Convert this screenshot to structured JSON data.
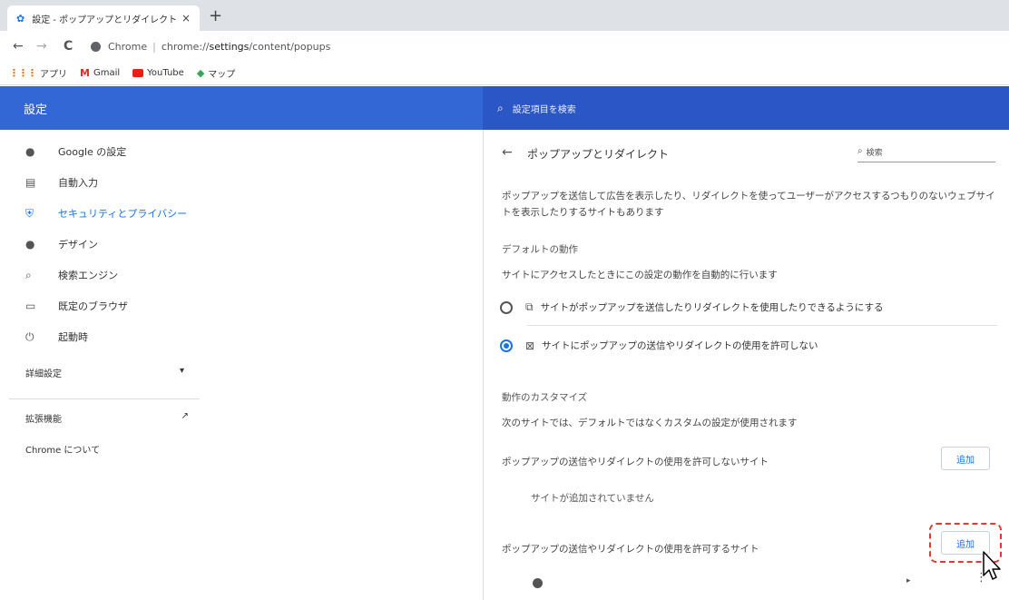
{
  "tab": {
    "title": "設定 - ポップアップとリダイレクト",
    "close": "×",
    "new_tab": "+"
  },
  "address": {
    "back": "←",
    "forward": "→",
    "reload": "C",
    "site_label": "Chrome",
    "separator": "|",
    "url_prefix": "chrome://",
    "url_host": "settings",
    "url_path": "/content/popups"
  },
  "bookmarks": [
    {
      "icon": "apps-grid-icon",
      "glyph": "⋮⋮⋮",
      "label": "アプリ"
    },
    {
      "icon": "gmail-icon",
      "glyph": "M",
      "label": "Gmail"
    },
    {
      "icon": "youtube-icon",
      "glyph": "",
      "label": "YouTube"
    },
    {
      "icon": "maps-icon",
      "glyph": "◆",
      "label": "マップ"
    }
  ],
  "header": {
    "title": "設定",
    "search_placeholder": "設定項目を検索"
  },
  "sidebar": {
    "items": [
      {
        "name": "google",
        "icon": "person-icon",
        "glyph": "👤",
        "label": "Google の設定",
        "active": false
      },
      {
        "name": "autofill",
        "icon": "clipboard-icon",
        "glyph": "▤",
        "label": "自動入力",
        "active": false
      },
      {
        "name": "privacy",
        "icon": "shield-icon",
        "glyph": "⛨",
        "label": "セキュリティとプライバシー",
        "active": true
      },
      {
        "name": "design",
        "icon": "palette-icon",
        "glyph": "●",
        "label": "デザイン",
        "active": false
      },
      {
        "name": "search",
        "icon": "search-icon",
        "glyph": "⌕",
        "label": "検索エンジン",
        "active": false
      },
      {
        "name": "browser",
        "icon": "browser-icon",
        "glyph": "▭",
        "label": "既定のブラウザ",
        "active": false
      },
      {
        "name": "startup",
        "icon": "power-icon",
        "glyph": "⏻",
        "label": "起動時",
        "active": false
      }
    ],
    "advanced": "詳細設定",
    "advanced_arrow": "▾",
    "extensions": "拡張機能",
    "extensions_icon": "↗",
    "about": "Chrome について"
  },
  "panel": {
    "back": "←",
    "title": "ポップアップとリダイレクト",
    "search_placeholder": "検索",
    "description": "ポップアップを送信して広告を表示したり、リダイレクトを使ってユーザーがアクセスするつもりのないウェブサイトを表示したりするサイトもあります",
    "default_heading": "デフォルトの動作",
    "default_sub": "サイトにアクセスしたときにこの設定の動作を自動的に行います",
    "options": [
      {
        "label": "サイトがポップアップを送信したりリダイレクトを使用したりできるようにする",
        "icon": "open-in-new-icon",
        "glyph": "⧉",
        "checked": false
      },
      {
        "label": "サイトにポップアップの送信やリダイレクトの使用を許可しない",
        "icon": "block-popup-icon",
        "glyph": "⊠",
        "checked": true
      }
    ],
    "custom_heading": "動作のカスタマイズ",
    "custom_sub": "次のサイトでは、デフォルトではなくカスタムの設定が使用されます",
    "block_label": "ポップアップの送信やリダイレクトの使用を許可しないサイト",
    "add_label": "追加",
    "empty_text": "サイトが追加されていません",
    "allow_label": "ポップアップの送信やリダイレクトの使用を許可するサイト",
    "site_row_arrow": "▸",
    "site_row_more": "⋮"
  }
}
